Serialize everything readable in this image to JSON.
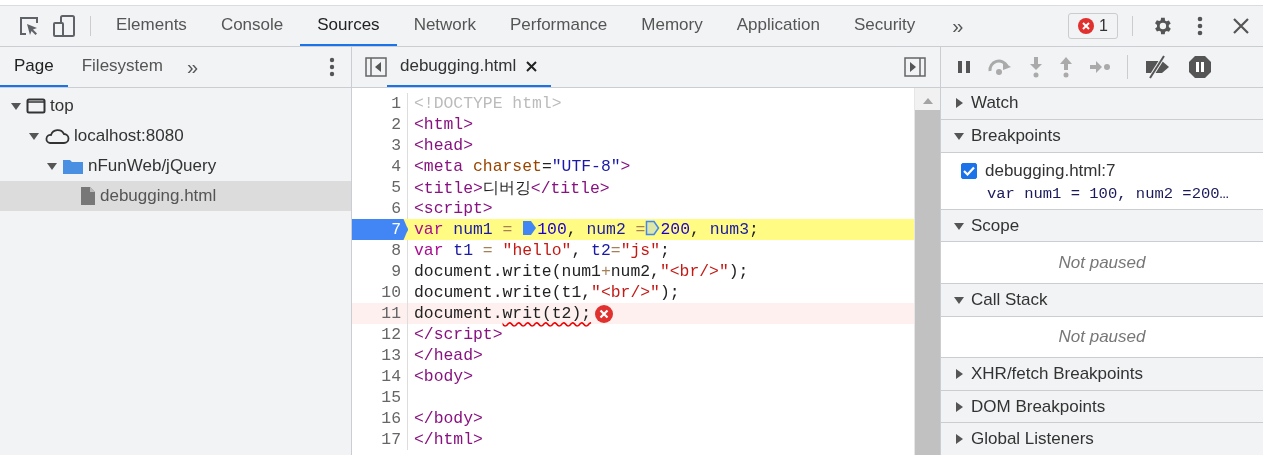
{
  "toolbar": {
    "tabs": [
      {
        "label": "Elements",
        "selected": false
      },
      {
        "label": "Console",
        "selected": false
      },
      {
        "label": "Sources",
        "selected": true
      },
      {
        "label": "Network",
        "selected": false
      },
      {
        "label": "Performance",
        "selected": false
      },
      {
        "label": "Memory",
        "selected": false
      },
      {
        "label": "Application",
        "selected": false
      },
      {
        "label": "Security",
        "selected": false
      }
    ],
    "more": "»",
    "error_count": "1"
  },
  "navigator": {
    "tabs": [
      {
        "label": "Page",
        "selected": true
      },
      {
        "label": "Filesystem",
        "selected": false
      }
    ],
    "more": "»",
    "tree": [
      {
        "label": "top",
        "kind": "frame",
        "expanded": true,
        "selected": false,
        "children": [
          {
            "label": "localhost:8080",
            "kind": "domain",
            "expanded": true,
            "selected": false,
            "children": [
              {
                "label": "nFunWeb/jQuery",
                "kind": "folder",
                "expanded": true,
                "selected": false,
                "children": [
                  {
                    "label": "debugging.html",
                    "kind": "file",
                    "selected": true
                  }
                ]
              }
            ]
          }
        ]
      }
    ]
  },
  "editor": {
    "tabs": [
      {
        "label": "debugging.html",
        "selected": true
      }
    ],
    "lines": [
      {
        "number": "1",
        "breakpoint": false,
        "highlighted": false,
        "error": false,
        "tokens": [
          {
            "t": "<!DOCTYPE html>",
            "kind": "doctype"
          }
        ]
      },
      {
        "number": "2",
        "breakpoint": false,
        "highlighted": false,
        "error": false,
        "tokens": [
          {
            "t": "<html>",
            "kind": "tag"
          }
        ]
      },
      {
        "number": "3",
        "breakpoint": false,
        "highlighted": false,
        "error": false,
        "tokens": [
          {
            "t": "<head>",
            "kind": "tag"
          }
        ]
      },
      {
        "number": "4",
        "breakpoint": false,
        "highlighted": false,
        "error": false,
        "tokens": [
          {
            "t": "<meta",
            "kind": "tag"
          },
          {
            "t": " charset",
            "kind": "attr"
          },
          {
            "t": "=",
            "kind": "plain"
          },
          {
            "t": "\"UTF-8\"",
            "kind": "value"
          },
          {
            "t": ">",
            "kind": "tag"
          }
        ]
      },
      {
        "number": "5",
        "breakpoint": false,
        "highlighted": false,
        "error": false,
        "tokens": [
          {
            "t": "<title>",
            "kind": "tag"
          },
          {
            "t": "디버깅",
            "kind": "plain"
          },
          {
            "t": "</title>",
            "kind": "tag"
          }
        ]
      },
      {
        "number": "6",
        "breakpoint": false,
        "highlighted": false,
        "error": false,
        "tokens": [
          {
            "t": "<script>",
            "kind": "tag"
          }
        ]
      },
      {
        "number": "7",
        "breakpoint": true,
        "highlighted": true,
        "error": false,
        "tokens": [
          {
            "t": "var",
            "kind": "keyword"
          },
          {
            "t": " num1",
            "kind": "variable"
          },
          {
            "t": " = ",
            "kind": "operator"
          },
          {
            "kind": "marker",
            "active": true
          },
          {
            "t": "100",
            "kind": "number"
          },
          {
            "t": ", ",
            "kind": "plain"
          },
          {
            "t": "num2",
            "kind": "variable"
          },
          {
            "t": " =",
            "kind": "operator"
          },
          {
            "kind": "marker",
            "active": false
          },
          {
            "t": "200",
            "kind": "number"
          },
          {
            "t": ", ",
            "kind": "plain"
          },
          {
            "t": "num3",
            "kind": "variable"
          },
          {
            "t": ";",
            "kind": "plain"
          }
        ]
      },
      {
        "number": "8",
        "breakpoint": false,
        "highlighted": false,
        "error": false,
        "tokens": [
          {
            "t": "var",
            "kind": "keyword"
          },
          {
            "t": " t1",
            "kind": "variable"
          },
          {
            "t": " = ",
            "kind": "operator"
          },
          {
            "t": "\"hello\"",
            "kind": "string"
          },
          {
            "t": ", ",
            "kind": "plain"
          },
          {
            "t": "t2",
            "kind": "variable"
          },
          {
            "t": "=",
            "kind": "operator"
          },
          {
            "t": "\"js\"",
            "kind": "string"
          },
          {
            "t": ";",
            "kind": "plain"
          }
        ]
      },
      {
        "number": "9",
        "breakpoint": false,
        "highlighted": false,
        "error": false,
        "tokens": [
          {
            "t": "document.write(num1",
            "kind": "plain"
          },
          {
            "t": "+",
            "kind": "operator"
          },
          {
            "t": "num2,",
            "kind": "plain"
          },
          {
            "t": "\"<br/>\"",
            "kind": "string"
          },
          {
            "t": ");",
            "kind": "plain"
          }
        ]
      },
      {
        "number": "10",
        "breakpoint": false,
        "highlighted": false,
        "error": false,
        "tokens": [
          {
            "t": "document.write(t1,",
            "kind": "plain"
          },
          {
            "t": "\"<br/>\"",
            "kind": "string"
          },
          {
            "t": ");",
            "kind": "plain"
          }
        ]
      },
      {
        "number": "11",
        "breakpoint": false,
        "highlighted": false,
        "error": true,
        "tokens": [
          {
            "t": "document.",
            "kind": "plain"
          },
          {
            "t": "writ(t2);",
            "kind": "plain",
            "squiggle": true
          }
        ]
      },
      {
        "number": "12",
        "breakpoint": false,
        "highlighted": false,
        "error": false,
        "tokens": [
          {
            "t": "</script>",
            "kind": "tag"
          }
        ]
      },
      {
        "number": "13",
        "breakpoint": false,
        "highlighted": false,
        "error": false,
        "tokens": [
          {
            "t": "</head>",
            "kind": "tag"
          }
        ]
      },
      {
        "number": "14",
        "breakpoint": false,
        "highlighted": false,
        "error": false,
        "tokens": [
          {
            "t": "<body>",
            "kind": "tag"
          }
        ]
      },
      {
        "number": "15",
        "breakpoint": false,
        "highlighted": false,
        "error": false
      },
      {
        "number": "16",
        "breakpoint": false,
        "highlighted": false,
        "error": false,
        "tokens": [
          {
            "t": "</body>",
            "kind": "tag"
          }
        ]
      },
      {
        "number": "17",
        "breakpoint": false,
        "highlighted": false,
        "error": false,
        "tokens": [
          {
            "t": "</html>",
            "kind": "tag"
          }
        ]
      }
    ]
  },
  "debugger": {
    "sections": [
      {
        "title": "Watch",
        "expanded": false
      },
      {
        "title": "Breakpoints",
        "expanded": true,
        "breakpoints": [
          {
            "location": "debugging.html:7",
            "code": "var num1 = 100, num2 =200…",
            "checked": true
          }
        ]
      },
      {
        "title": "Scope",
        "expanded": true,
        "message": "Not paused"
      },
      {
        "title": "Call Stack",
        "expanded": true,
        "message": "Not paused"
      },
      {
        "title": "XHR/fetch Breakpoints",
        "expanded": false
      },
      {
        "title": "DOM Breakpoints",
        "expanded": false
      },
      {
        "title": "Global Listeners",
        "expanded": false
      }
    ]
  }
}
